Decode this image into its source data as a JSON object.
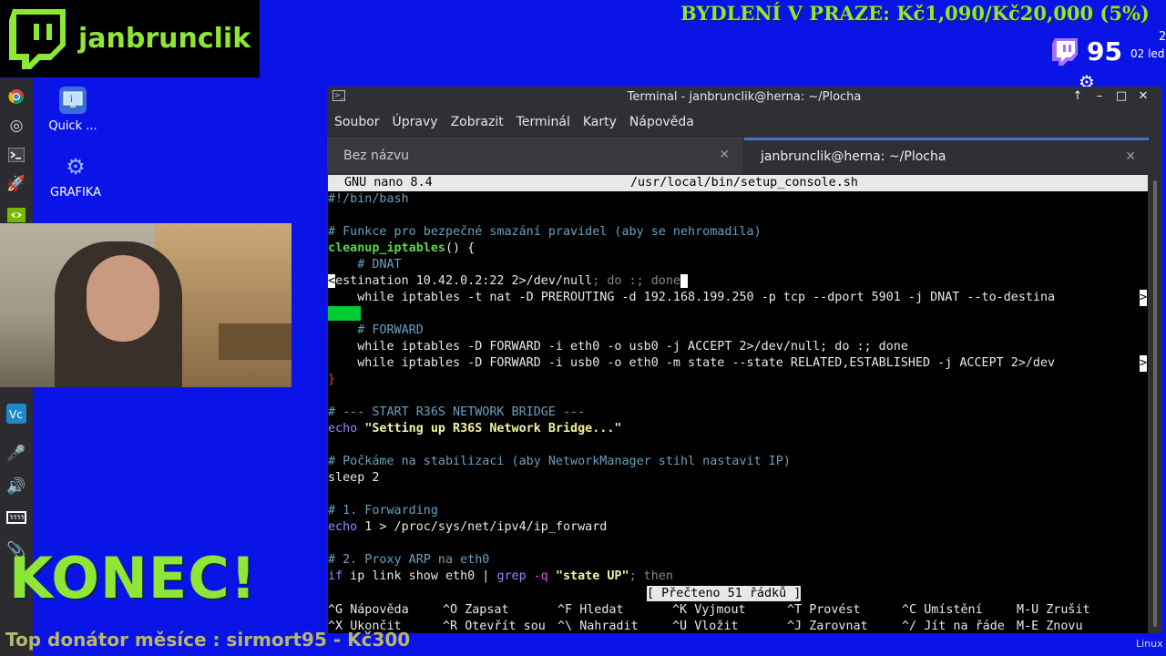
{
  "overlay": {
    "channel_name": "janbrunclik",
    "banner_text": "BYDLENÍ V PRAZE: Kč1,090/Kč20,000 (5%)",
    "viewer_count": "95",
    "clock_hour": "2",
    "clock_date": "02 led",
    "konec_text": "KONEC!",
    "donor_text": "Top donátor měsíce : sirmort95 - Kč300"
  },
  "desktop": {
    "icons": [
      {
        "label": "Quick ..."
      },
      {
        "label": "GRAFIKA"
      }
    ],
    "taskbar_label": "Linux"
  },
  "window": {
    "title": "Terminal - janbrunclik@herna: ~/Plocha",
    "menu": [
      "Soubor",
      "Úpravy",
      "Zobrazit",
      "Terminál",
      "Karty",
      "Nápověda"
    ],
    "tabs": [
      {
        "label": "Bez názvu",
        "active": false
      },
      {
        "label": "janbrunclik@herna: ~/Plocha",
        "active": true
      }
    ]
  },
  "nano": {
    "header_left": "GNU nano 8.4",
    "header_file": "/usr/local/bin/setup_console.sh",
    "status": "[ Přečteno 51 řádků ]",
    "lines": {
      "l1": "#!/bin/bash",
      "l3": "# Funkce pro bezpečné smazání pravidel (aby se nehromadila)",
      "l4_fn": "cleanup_iptables",
      "l4_rest": "() {",
      "l5": "    # DNAT",
      "l6_a": "<",
      "l6_b": "estination 10.42.0.2:22 2>/dev/null",
      "l6_c": "; do :; done",
      "l7": "    while iptables -t nat -D PREROUTING -d 192.168.199.250 -p tcp --dport 5901 -j DNAT --to-destina",
      "l9": "    # FORWARD",
      "l10": "    while iptables -D FORWARD -i eth0 -o usb0 -j ACCEPT 2>/dev/null; do :; done",
      "l11": "    while iptables -D FORWARD -i usb0 -o eth0 -m state --state RELATED,ESTABLISHED -j ACCEPT 2>/dev",
      "l12": "}",
      "l14": "# --- START R36S NETWORK BRIDGE ---",
      "l15_kw": "echo",
      "l15_str": "\"Setting up R36S Network Bridge...\"",
      "l17": "# Počkáme na stabilizaci (aby NetworkManager stihl nastavit IP)",
      "l18": "sleep 2",
      "l20": "# 1. Forwarding",
      "l21_kw": "echo",
      "l21_rest": " 1 > /proc/sys/net/ipv4/ip_forward",
      "l23": "# 2. Proxy ARP na eth0",
      "l24_kw": "if",
      "l24_a": " ip link show eth0 | ",
      "l24_grep": "grep",
      "l24_opt": " -q ",
      "l24_str": "\"state UP\"",
      "l24_end": "; then"
    },
    "shortcuts": [
      [
        {
          "key": "^G",
          "label": "Nápověda"
        },
        {
          "key": "^O",
          "label": "Zapsat"
        },
        {
          "key": "^F",
          "label": "Hledat"
        },
        {
          "key": "^K",
          "label": "Vyjmout"
        },
        {
          "key": "^T",
          "label": "Provést"
        },
        {
          "key": "^C",
          "label": "Umístění"
        },
        {
          "key": "M-U",
          "label": "Zrušit"
        }
      ],
      [
        {
          "key": "^X",
          "label": "Ukončit"
        },
        {
          "key": "^R",
          "label": "Otevřít sou"
        },
        {
          "key": "^\\",
          "label": "Nahradit"
        },
        {
          "key": "^U",
          "label": "Vložit"
        },
        {
          "key": "^J",
          "label": "Zarovnat"
        },
        {
          "key": "^/",
          "label": "Jít na řáde"
        },
        {
          "key": "M-E",
          "label": "Znovu"
        }
      ]
    ]
  },
  "colors": {
    "desktop_bg": "#0a14e6",
    "overlay_green": "#8ee636",
    "tab_accent": "#4a74c9"
  }
}
